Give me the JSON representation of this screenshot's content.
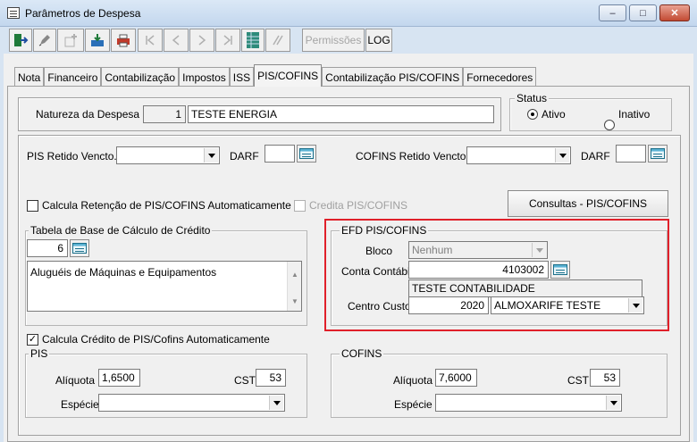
{
  "window": {
    "title": "Parâmetros de Despesa",
    "controls": {
      "minimize": "–",
      "maximize": "□",
      "close": "✕"
    }
  },
  "toolbar": {
    "permissions_label": "Permissões",
    "log_label": "LOG"
  },
  "tabs": [
    {
      "label": "Nota"
    },
    {
      "label": "Financeiro"
    },
    {
      "label": "Contabilização"
    },
    {
      "label": "Impostos"
    },
    {
      "label": "ISS"
    },
    {
      "label": "PIS/COFINS"
    },
    {
      "label": "Contabilização PIS/COFINS"
    },
    {
      "label": "Fornecedores"
    }
  ],
  "active_tab": "PIS/COFINS",
  "header": {
    "natureza_label": "Natureza da Despesa",
    "natureza_code": "1",
    "natureza_desc": "TESTE ENERGIA"
  },
  "status": {
    "legend": "Status",
    "ativo": "Ativo",
    "inativo": "Inativo",
    "selected": "Ativo"
  },
  "retido": {
    "pis_label": "PIS Retido Vencto.",
    "pis_value": "",
    "darf_label": "DARF",
    "pis_darf_value": "",
    "cofins_label": "COFINS Retido Vencto.",
    "cofins_value": "",
    "cofins_darf_value": ""
  },
  "options": {
    "calc_retencao": "Calcula Retenção de PIS/COFINS Automaticamente",
    "credita": "Credita PIS/COFINS",
    "consultas_button": "Consultas - PIS/COFINS",
    "calc_credito": "Calcula Crédito de PIS/Cofins Automaticamente"
  },
  "tabela": {
    "legend": "Tabela de Base de Cálculo de Crédito",
    "code": "6",
    "description": "Aluguéis de Máquinas e Equipamentos"
  },
  "efd": {
    "legend": "EFD PIS/COFINS",
    "bloco_label": "Bloco",
    "bloco_value": "Nenhum",
    "conta_label": "Conta Contábil",
    "conta_value": "4103002",
    "conta_desc": "TESTE CONTABILIDADE",
    "centro_label": "Centro Custo",
    "centro_code": "2020",
    "centro_desc": "ALMOXARIFE TESTE"
  },
  "pis": {
    "legend": "PIS",
    "aliquota_label": "Alíquota",
    "aliquota_value": "1,6500",
    "cst_label": "CST",
    "cst_value": "53",
    "especie_label": "Espécie",
    "especie_value": ""
  },
  "cofins": {
    "legend": "COFINS",
    "aliquota_label": "Alíquota",
    "aliquota_value": "7,6000",
    "cst_label": "CST",
    "cst_value": "53",
    "especie_label": "Espécie",
    "especie_value": ""
  },
  "colors": {
    "highlight_border": "#e0202a",
    "titlebar": "#c3d7ee"
  }
}
